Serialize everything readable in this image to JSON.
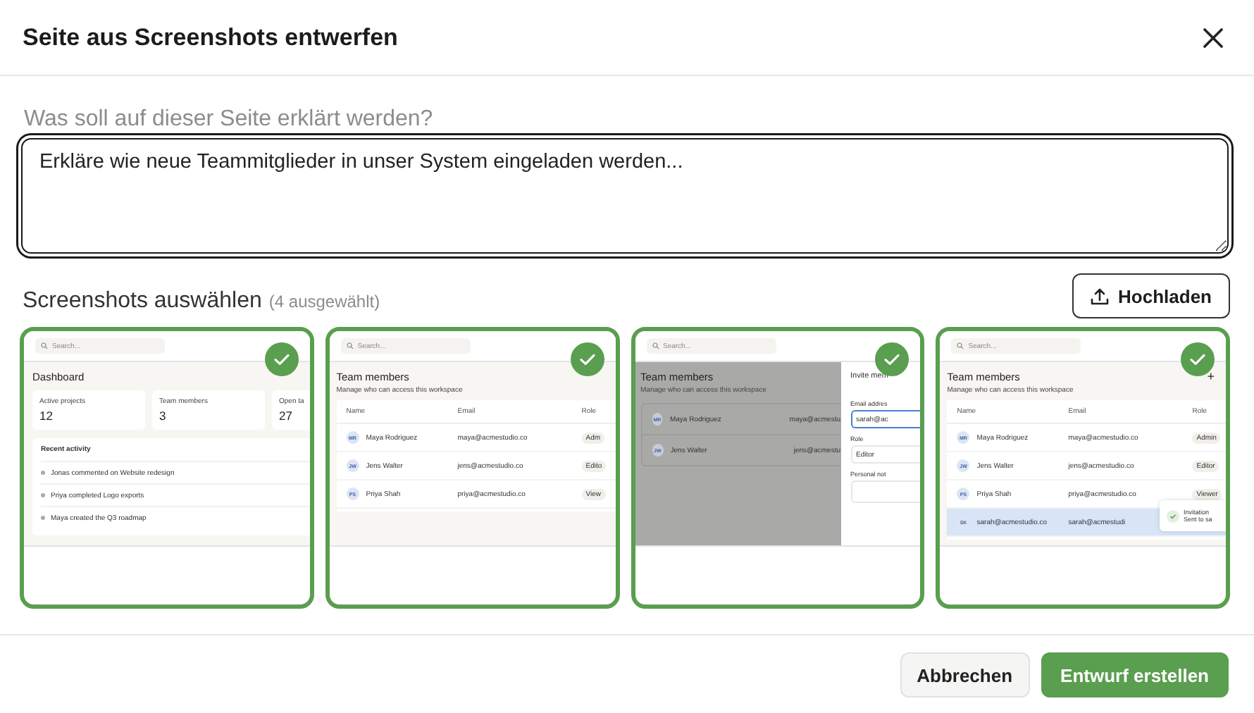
{
  "dialog": {
    "title": "Seite aus Screenshots entwerfen"
  },
  "prompt": {
    "label": "Was soll auf dieser Seite erklärt werden?",
    "value": "Erkläre wie neue Teammitglieder in unser System eingeladen werden..."
  },
  "screenshots_section": {
    "title": "Screenshots auswählen",
    "count": "(4 ausgewählt)",
    "upload_button": "Hochladen"
  },
  "screenshots": [
    {
      "kind": "dashboard",
      "selected": true,
      "search_placeholder": "Search...",
      "title": "Dashboard",
      "stats": [
        {
          "label": "Active projects",
          "value": "12"
        },
        {
          "label": "Team members",
          "value": "3"
        },
        {
          "label": "Open ta",
          "value": "27"
        }
      ],
      "activity_title": "Recent activity",
      "activity": [
        "Jonas commented on Website redesign",
        "Priya completed Logo exports",
        "Maya created the Q3 roadmap"
      ]
    },
    {
      "kind": "members",
      "selected": true,
      "search_placeholder": "Search...",
      "title": "Team members",
      "subtitle": "Manage who can access this workspace",
      "columns": [
        "Name",
        "Email",
        "Role"
      ],
      "rows": [
        {
          "initials": "MR",
          "name": "Maya Rodriguez",
          "email": "maya@acmestudio.co",
          "role": "Adm",
          "highlighted": false
        },
        {
          "initials": "JW",
          "name": "Jens Walter",
          "email": "jens@acmestudio.co",
          "role": "Edito",
          "highlighted": false
        },
        {
          "initials": "PS",
          "name": "Priya Shah",
          "email": "priya@acmestudio.co",
          "role": "View",
          "highlighted": false
        }
      ]
    },
    {
      "kind": "invite",
      "selected": true,
      "search_placeholder": "Search...",
      "title": "Team members",
      "subtitle": "Manage who can access this workspace",
      "rows": [
        {
          "initials": "MR",
          "name": "Maya Rodriguez",
          "email": "maya@acmestu"
        },
        {
          "initials": "JW",
          "name": "Jens Walter",
          "email": "jens@acmestu"
        }
      ],
      "panel": {
        "title": "Invite mem",
        "email_label": "Email addres",
        "email_value": "sarah@ac",
        "role_label": "Role",
        "role_value": "Editor",
        "note_label": "Personal not"
      }
    },
    {
      "kind": "members",
      "selected": true,
      "search_placeholder": "Search...",
      "title": "Team members",
      "subtitle": "Manage who can access this workspace",
      "add_label": "+",
      "columns": [
        "Name",
        "Email",
        "Role"
      ],
      "rows": [
        {
          "initials": "MR",
          "name": "Maya Rodriguez",
          "email": "maya@acmestudio.co",
          "role": "Admin",
          "highlighted": false
        },
        {
          "initials": "JW",
          "name": "Jens Walter",
          "email": "jens@acmestudio.co",
          "role": "Editor",
          "highlighted": false
        },
        {
          "initials": "PS",
          "name": "Priya Shah",
          "email": "priya@acmestudio.co",
          "role": "Viewer",
          "highlighted": false
        },
        {
          "initials": "SK",
          "name": "sarah@acmestudio.co",
          "email": "sarah@acmestudi",
          "highlighted": true
        }
      ],
      "toast": {
        "title": "Invitation",
        "text": "Sent to sa"
      }
    }
  ],
  "footer": {
    "buttons": [
      {
        "label": "Abbrechen",
        "kind": "secondary"
      },
      {
        "label": "Entwurf erstellen",
        "kind": "primary"
      }
    ]
  }
}
